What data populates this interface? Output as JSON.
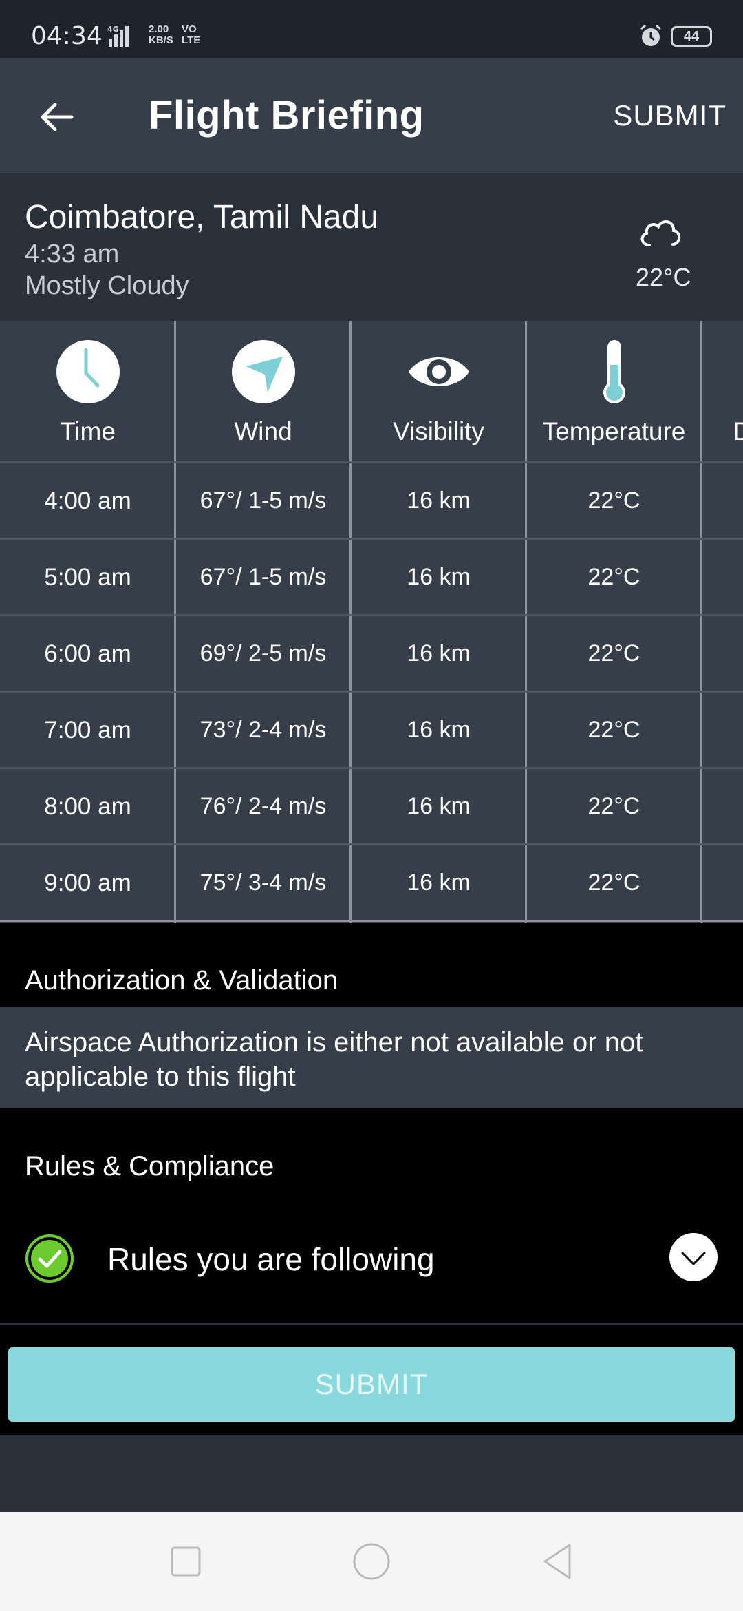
{
  "status_bar": {
    "time": "04:34",
    "network_type": "4G",
    "speed_value": "2.00",
    "speed_unit": "KB/S",
    "volte_1": "VO",
    "volte_2": "LTE",
    "battery": "44"
  },
  "app_bar": {
    "title": "Flight Briefing",
    "submit_label": "SUBMIT"
  },
  "location": {
    "place": "Coimbatore, Tamil Nadu",
    "time": "4:33 am",
    "condition": "Mostly Cloudy",
    "temperature": "22°C"
  },
  "forecast": {
    "columns": [
      "Time",
      "Wind",
      "Visibility",
      "Temperature",
      "D"
    ],
    "rows": [
      {
        "time": "4:00 am",
        "wind": "67°/ 1-5 m/s",
        "visibility": "16 km",
        "temperature": "22°C"
      },
      {
        "time": "5:00 am",
        "wind": "67°/ 1-5 m/s",
        "visibility": "16 km",
        "temperature": "22°C"
      },
      {
        "time": "6:00 am",
        "wind": "69°/ 2-5 m/s",
        "visibility": "16 km",
        "temperature": "22°C"
      },
      {
        "time": "7:00 am",
        "wind": "73°/ 2-4 m/s",
        "visibility": "16 km",
        "temperature": "22°C"
      },
      {
        "time": "8:00 am",
        "wind": "76°/ 2-4 m/s",
        "visibility": "16 km",
        "temperature": "22°C"
      },
      {
        "time": "9:00 am",
        "wind": "75°/ 3-4 m/s",
        "visibility": "16 km",
        "temperature": "22°C"
      }
    ]
  },
  "authorization": {
    "heading": "Authorization & Validation",
    "message": "Airspace Authorization is either not available or not applicable to this flight"
  },
  "rules": {
    "heading": "Rules & Compliance",
    "item_label": "Rules you are following"
  },
  "submit_button": {
    "label": "SUBMIT"
  },
  "colors": {
    "accent": "#88d8dd",
    "check_green": "#6ccb2f",
    "panel": "#353e49",
    "background": "#2b313b"
  }
}
